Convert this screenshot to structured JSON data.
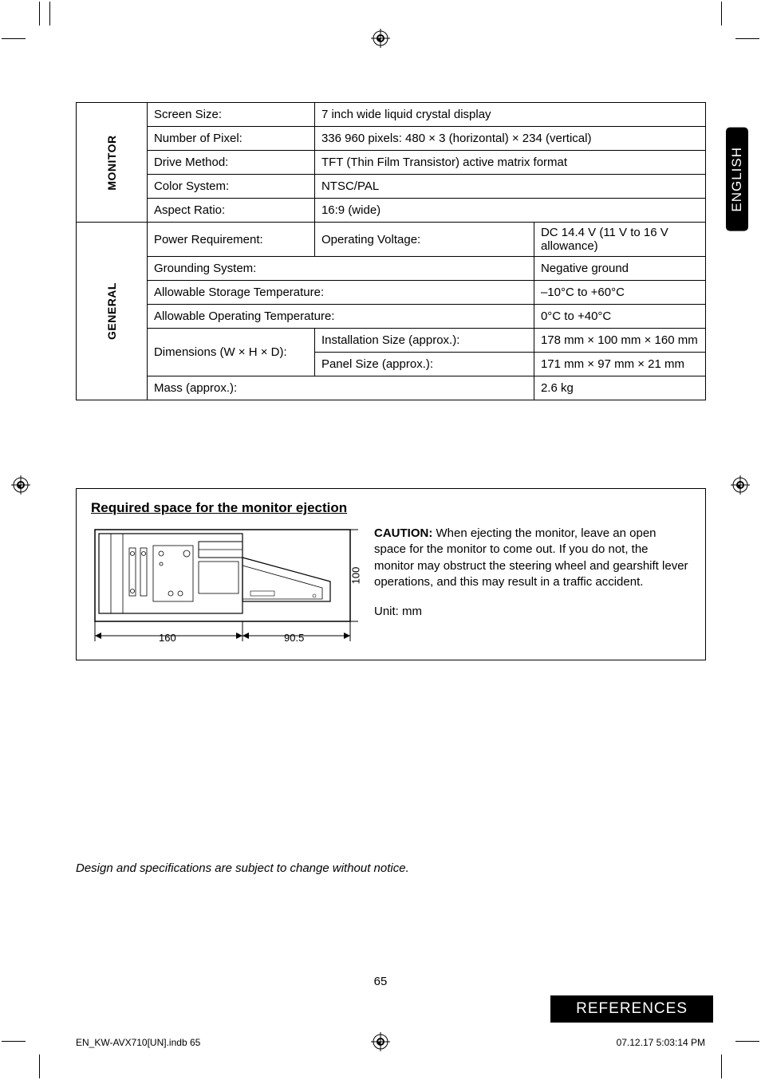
{
  "lang_tab": "ENGLISH",
  "spec": {
    "monitor_label": "MONITOR",
    "general_label": "GENERAL",
    "rows": {
      "screen_size_label": "Screen Size:",
      "screen_size_value": "7 inch wide liquid crystal display",
      "pixel_label": "Number of Pixel:",
      "pixel_value": "336 960 pixels: 480 × 3 (horizontal) × 234 (vertical)",
      "drive_label": "Drive Method:",
      "drive_value": "TFT (Thin Film Transistor) active matrix format",
      "color_label": "Color System:",
      "color_value": "NTSC/PAL",
      "aspect_label": "Aspect Ratio:",
      "aspect_value": "16:9 (wide)",
      "power_label": "Power Requirement:",
      "operating_voltage_label": "Operating Voltage:",
      "operating_voltage_value": "DC 14.4 V (11 V to 16 V allowance)",
      "grounding_label": "Grounding System:",
      "grounding_value": "Negative ground",
      "storage_temp_label": "Allowable Storage Temperature:",
      "storage_temp_value": "–10°C to +60°C",
      "operating_temp_label": "Allowable Operating Temperature:",
      "operating_temp_value": "0°C to +40°C",
      "dimensions_label": "Dimensions (W × H × D):",
      "install_size_label": "Installation Size (approx.):",
      "install_size_value": "178 mm × 100 mm × 160 mm",
      "panel_size_label": "Panel Size (approx.):",
      "panel_size_value": "171 mm × 97 mm × 21 mm",
      "mass_label": "Mass (approx.):",
      "mass_value": "2.6 kg"
    }
  },
  "box": {
    "heading": "Required space for the monitor ejection",
    "dims": {
      "w1": "160",
      "w2": "90.5",
      "h": "100"
    },
    "caution_label": "CAUTION:",
    "caution_text": " When ejecting the monitor, leave an open space for the monitor to come out. If you do not, the monitor may obstruct the steering wheel and gearshift lever operations, and this may result in a traffic accident.",
    "unit": "Unit: mm"
  },
  "disclaimer": "Design and specifications are subject to change without notice.",
  "page_number": "65",
  "references": "REFERENCES",
  "footer_left": "EN_KW-AVX710[UN].indb   65",
  "footer_right": "07.12.17   5:03:14 PM"
}
